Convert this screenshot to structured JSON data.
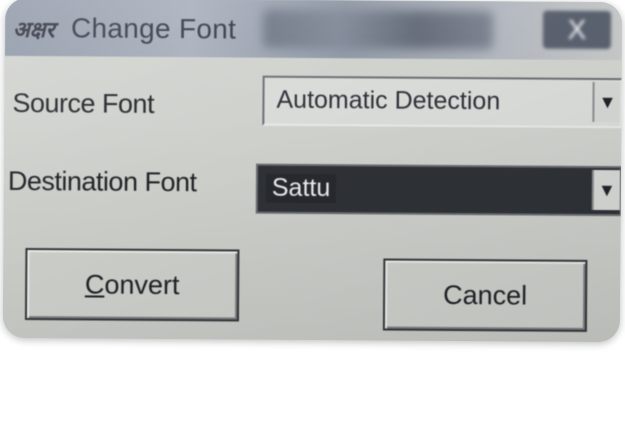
{
  "window": {
    "icon_glyph": "अक्षर",
    "title": "Change Font",
    "close_label": "X"
  },
  "source_font": {
    "label": "Source Font",
    "value": "Automatic Detection"
  },
  "destination_font": {
    "label": "Destination Font",
    "value": "Sattu"
  },
  "buttons": {
    "convert_mnemonic": "C",
    "convert_rest": "onvert",
    "cancel": "Cancel"
  },
  "icons": {
    "dropdown": "chevron-down-icon",
    "app": "app-logo-icon",
    "close": "close-icon"
  },
  "colors": {
    "titlebar": "#8e97a6",
    "dialog_bg": "#d0d2ce",
    "selected_combo_bg": "#2e3136"
  }
}
